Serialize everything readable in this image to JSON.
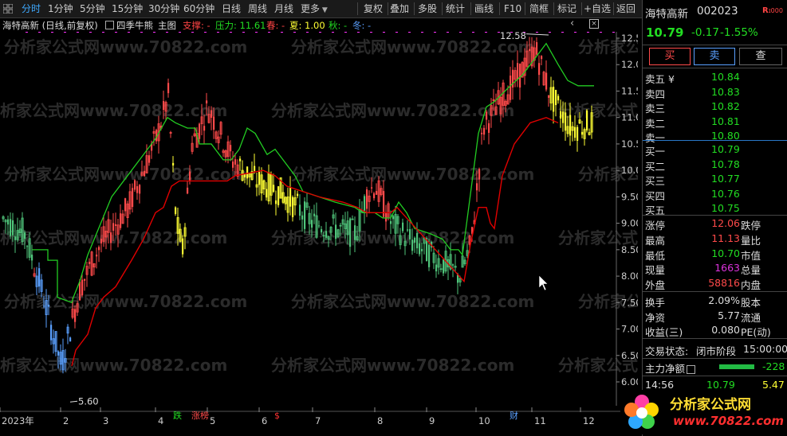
{
  "toolbar": {
    "left_tabs": [
      "分时",
      "1分钟",
      "5分钟",
      "15分钟",
      "30分钟",
      "60分钟",
      "日线",
      "周线",
      "月线",
      "更多"
    ],
    "right_buttons": [
      "复权",
      "叠加",
      "多股",
      "统计",
      "画线",
      "F10",
      "简框",
      "标记",
      "+自选",
      "返回"
    ]
  },
  "indicator_line": {
    "stock_label": "海特高新 (日线,前复权)",
    "indicator_name": "四季牛熊",
    "main_label": "主图",
    "support": "支撑: -",
    "pressure": "压力: 11.61",
    "spring": "春: -",
    "summer": "夏: 1.00",
    "autumn": "秋: -",
    "winter": "冬: -"
  },
  "watermark": "分析家公式网www.70822.com",
  "chart_data": {
    "type": "candlestick",
    "y_ticks": [
      "12.50",
      "12.00",
      "11.50",
      "11.00",
      "10.50",
      "10.00",
      "9.50",
      "9.00",
      "8.50",
      "8.00",
      "7.50",
      "7.00",
      "6.50",
      "6.00"
    ],
    "ylim": [
      5.6,
      12.6
    ],
    "x_labels": [
      "2023年",
      "2",
      "3",
      "4",
      "5",
      "6",
      "7",
      "8",
      "9",
      "10",
      "11",
      "12"
    ],
    "high_annotation": "12.58",
    "low_annotation": "5.60",
    "event_tags": [
      "跌",
      "涨榜",
      "$",
      "财"
    ],
    "colors": {
      "red": "#ff4a4a",
      "yellow": "#ffff33",
      "green": "#4fc47a",
      "blue": "#5aa0ff",
      "support_line": "#e00000",
      "pressure_line": "#22cc22",
      "magenta": "#ff33ff"
    }
  },
  "panel": {
    "stock_name": "海特高新",
    "stock_code": "002023",
    "badge": "R",
    "last_price": "10.79",
    "change": "-0.17",
    "change_pct": "-1.55%",
    "buy_label": "买",
    "sell_label": "卖",
    "query_label": "查",
    "asks": [
      {
        "label": "卖五 ¥",
        "price": "10.84"
      },
      {
        "label": "卖四",
        "price": "10.83"
      },
      {
        "label": "卖三",
        "price": "10.82"
      },
      {
        "label": "卖二",
        "price": "10.81"
      },
      {
        "label": "卖一",
        "price": "10.80"
      }
    ],
    "bids": [
      {
        "label": "买一",
        "price": "10.79"
      },
      {
        "label": "买二",
        "price": "10.78"
      },
      {
        "label": "买三",
        "price": "10.77"
      },
      {
        "label": "买四",
        "price": "10.76"
      },
      {
        "label": "买五",
        "price": "10.75"
      }
    ],
    "stats": [
      {
        "k": "涨停",
        "v": "12.06",
        "k2": "跌停"
      },
      {
        "k": "最高",
        "v": "11.13",
        "k2": "量比"
      },
      {
        "k": "最低",
        "v": "10.70",
        "k2": "市值"
      },
      {
        "k": "现量",
        "v": "1663",
        "k2": "总量"
      },
      {
        "k": "外盘",
        "v": "58816",
        "k2": "内盘"
      }
    ],
    "stats2": [
      {
        "k": "换手",
        "v": "2.09%",
        "k2": "股本"
      },
      {
        "k": "净资",
        "v": "5.77",
        "k2": "流通"
      },
      {
        "k": "收益(三)",
        "v": "0.080",
        "k2": "PE(动)"
      }
    ],
    "trade_state_label": "交易状态:",
    "trade_state": "闭市阶段",
    "trade_time": "15:00:00",
    "main_flow_label": "主力净额",
    "main_flow_value": "-228",
    "tick_time": "14:56",
    "tick_price": "10.79",
    "tick_vol": "5.47",
    "logo_text": "分析家公式网",
    "logo_url": "www.70822.com"
  }
}
